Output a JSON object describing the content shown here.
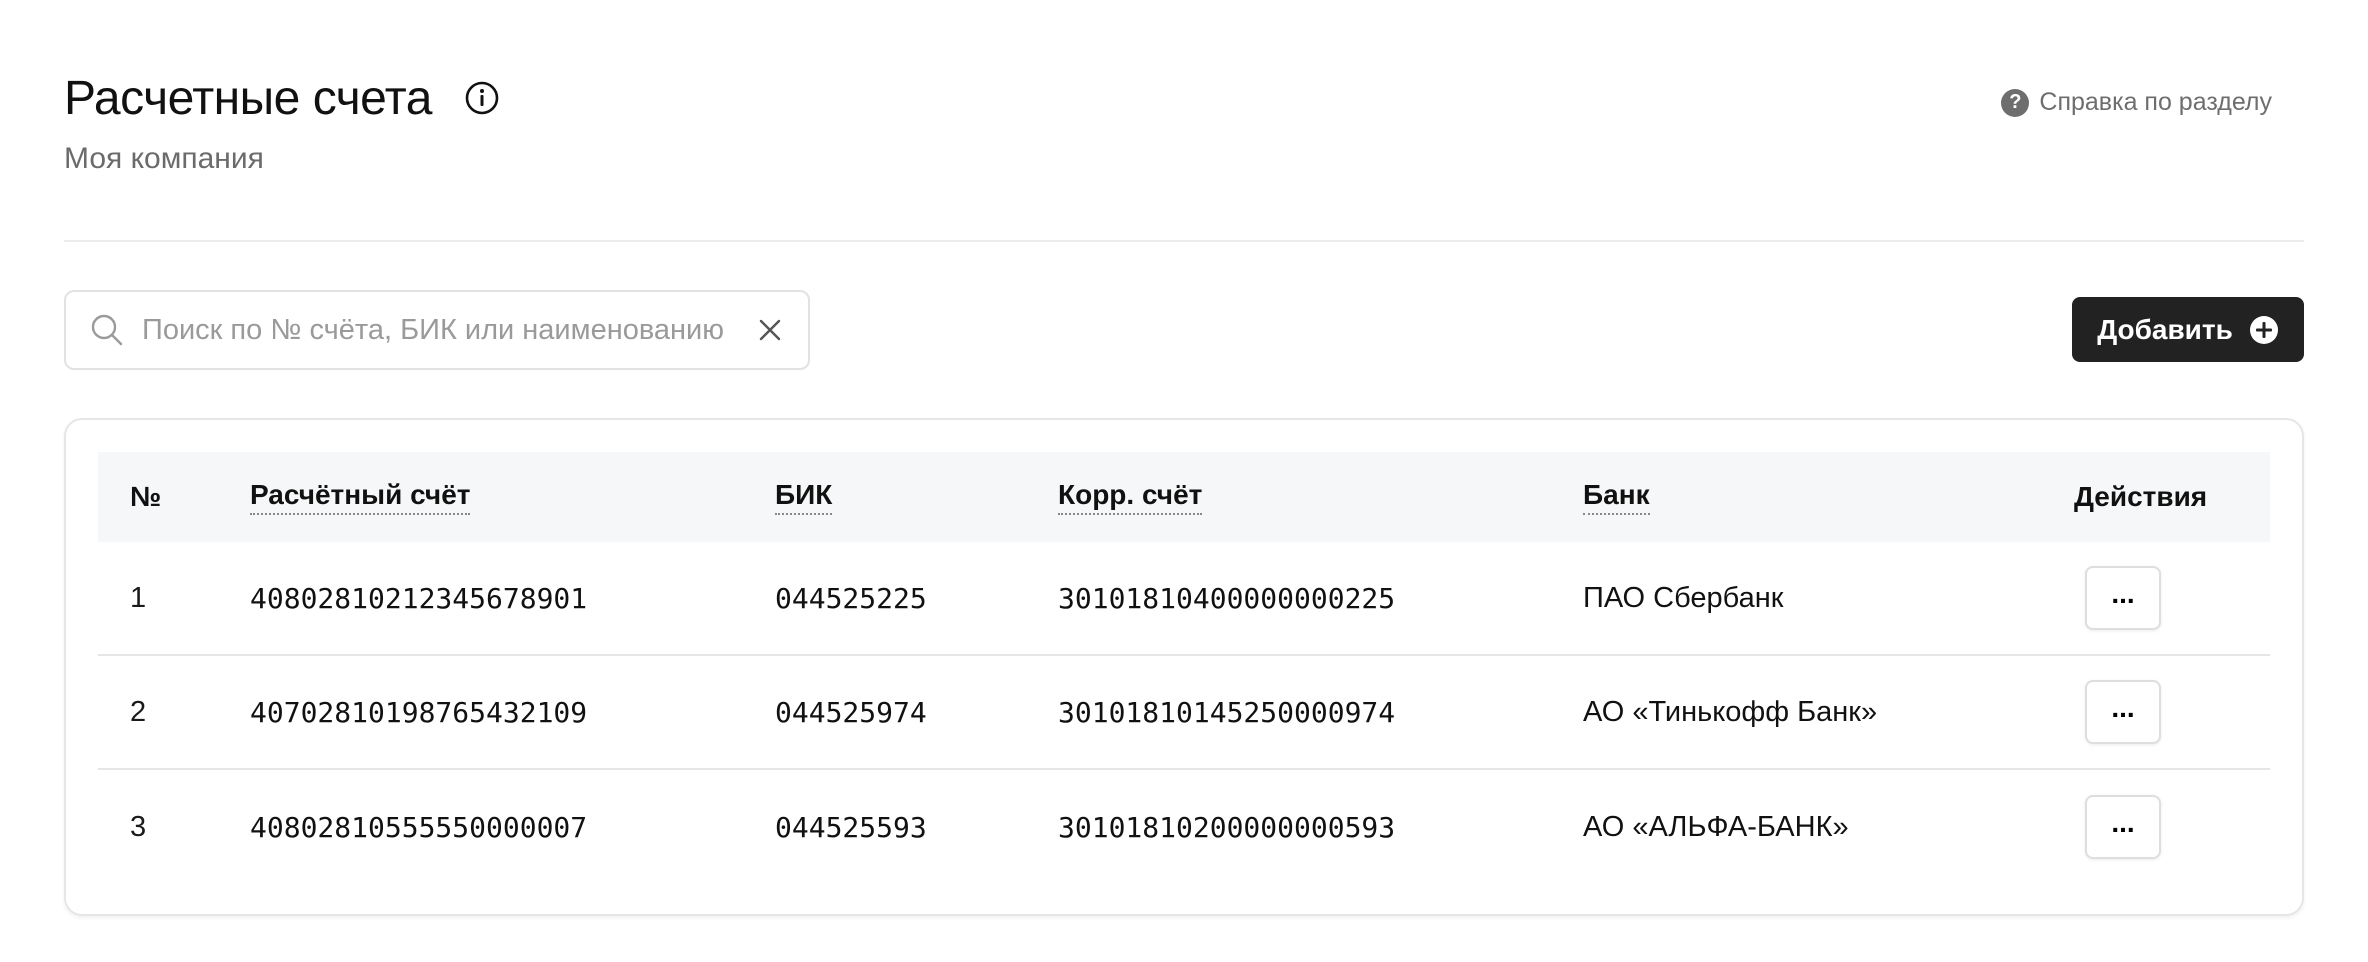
{
  "header": {
    "title": "Расчетные счета",
    "subtitle": "Моя компания",
    "help_link": "Справка по разделу"
  },
  "search": {
    "placeholder": "Поиск по № счёта, БИК или наименованию",
    "value": ""
  },
  "toolbar": {
    "add_label": "Добавить"
  },
  "table": {
    "columns": [
      "№",
      "Расчётный счёт",
      "БИК",
      "Корр. счёт",
      "Банк",
      "Действия"
    ],
    "rows": [
      {
        "num": "1",
        "account": "40802810212345678901",
        "bik": "044525225",
        "corr": "30101810400000000225",
        "bank": "ПАО Сбербанк",
        "action": "..."
      },
      {
        "num": "2",
        "account": "40702810198765432109",
        "bik": "044525974",
        "corr": "30101810145250000974",
        "bank": "АО «Тинькофф Банк»",
        "action": "..."
      },
      {
        "num": "3",
        "account": "40802810555550000007",
        "bik": "044525593",
        "corr": "30101810200000000593",
        "bank": "АО «АЛЬФА-БАНК»",
        "action": "..."
      }
    ]
  },
  "icons": {
    "info": "info-icon",
    "help": "question-circle-icon",
    "search": "search-icon",
    "clear": "close-icon",
    "add": "plus-circle-icon"
  },
  "colors": {
    "primary_button": "#222222",
    "header_bg": "#f6f7f8",
    "muted_text": "#6b6b6b"
  }
}
